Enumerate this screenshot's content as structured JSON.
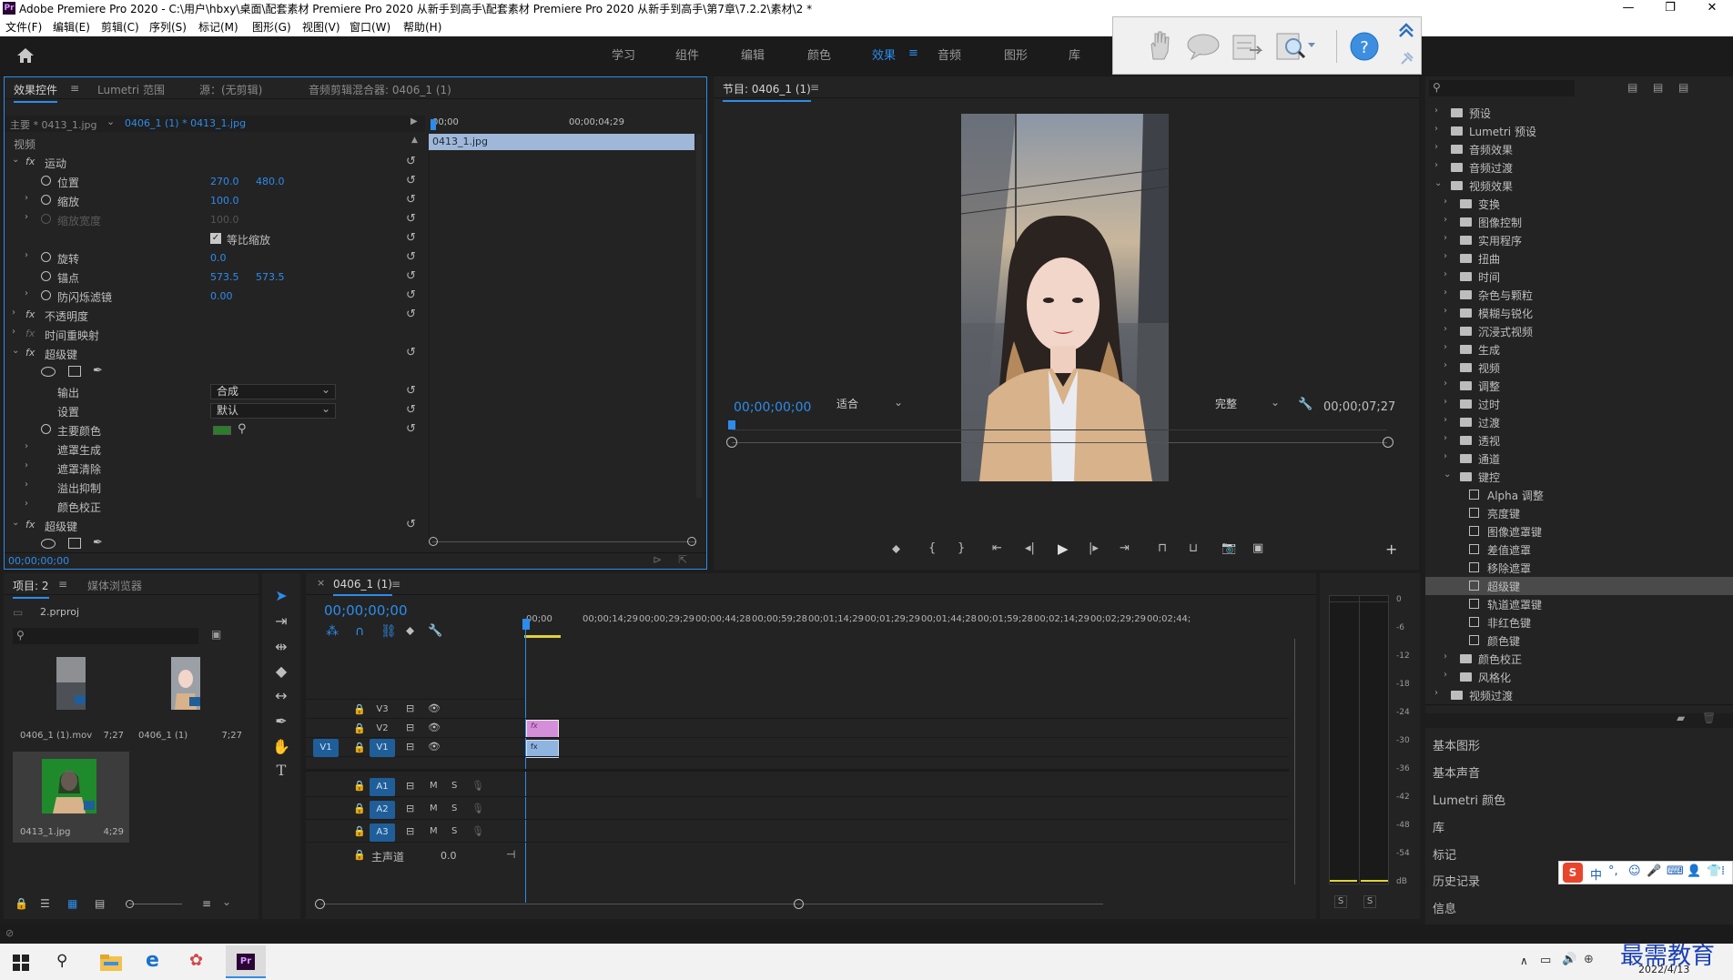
{
  "window": {
    "title": "Adobe Premiere Pro 2020 - C:\\用户\\hbxy\\桌面\\配套素材 Premiere Pro 2020 从新手到高手\\配套素材 Premiere Pro 2020 从新手到高手\\第7章\\7.2.2\\素材\\2 *",
    "app_icon": "Pr"
  },
  "menu": [
    "文件(F)",
    "编辑(E)",
    "剪辑(C)",
    "序列(S)",
    "标记(M)",
    "图形(G)",
    "视图(V)",
    "窗口(W)",
    "帮助(H)"
  ],
  "workspaces": {
    "tabs": [
      "学习",
      "组件",
      "编辑",
      "颜色",
      "效果",
      "音频",
      "图形",
      "库"
    ],
    "active": "效果"
  },
  "effect_controls": {
    "tabs": [
      "效果控件",
      "Lumetri 范围",
      "源：(无剪辑)",
      "音频剪辑混合器: 0406_1 (1)"
    ],
    "master": "主要 * 0413_1.jpg",
    "clip": "0406_1 (1) * 0413_1.jpg",
    "time_start": "00;00",
    "time_mid": "00;00;04;29",
    "clip_bar": "0413_1.jpg",
    "section_video": "视频",
    "motion": "运动",
    "position_label": "位置",
    "position_x": "270.0",
    "position_y": "480.0",
    "scale_label": "缩放",
    "scale_value": "100.0",
    "scale_width_label": "缩放宽度",
    "scale_width_value": "100.0",
    "uniform_label": "等比缩放",
    "rotation_label": "旋转",
    "rotation_value": "0.0",
    "anchor_label": "锚点",
    "anchor_x": "573.5",
    "anchor_y": "573.5",
    "flicker_label": "防闪烁滤镜",
    "flicker_value": "0.00",
    "opacity": "不透明度",
    "time_remap": "时间重映射",
    "ultra_key": "超级键",
    "output_label": "输出",
    "output_value": "合成",
    "setting_label": "设置",
    "setting_value": "默认",
    "key_color_label": "主要颜色",
    "key_color": "#2a7d2a",
    "matte_gen": "遮罩生成",
    "matte_clean": "遮罩清除",
    "spill": "溢出抑制",
    "color_correct": "颜色校正",
    "ultra_key2": "超级键",
    "timecode": "00;00;00;00"
  },
  "program_monitor": {
    "title": "节目: 0406_1 (1)",
    "timecode": "00;00;00;00",
    "fit": "适合",
    "quality": "完整",
    "duration": "00;00;07;27"
  },
  "effects_panel": {
    "items": [
      {
        "label": "预设",
        "level": 0,
        "type": "folder",
        "open": false
      },
      {
        "label": "Lumetri 预设",
        "level": 0,
        "type": "folder",
        "open": false
      },
      {
        "label": "音频效果",
        "level": 0,
        "type": "folder",
        "open": false
      },
      {
        "label": "音频过渡",
        "level": 0,
        "type": "folder",
        "open": false
      },
      {
        "label": "视频效果",
        "level": 0,
        "type": "folder",
        "open": true
      },
      {
        "label": "变换",
        "level": 1,
        "type": "folder",
        "open": false
      },
      {
        "label": "图像控制",
        "level": 1,
        "type": "folder",
        "open": false
      },
      {
        "label": "实用程序",
        "level": 1,
        "type": "folder",
        "open": false
      },
      {
        "label": "扭曲",
        "level": 1,
        "type": "folder",
        "open": false
      },
      {
        "label": "时间",
        "level": 1,
        "type": "folder",
        "open": false
      },
      {
        "label": "杂色与颗粒",
        "level": 1,
        "type": "folder",
        "open": false
      },
      {
        "label": "模糊与锐化",
        "level": 1,
        "type": "folder",
        "open": false
      },
      {
        "label": "沉浸式视频",
        "level": 1,
        "type": "folder",
        "open": false
      },
      {
        "label": "生成",
        "level": 1,
        "type": "folder",
        "open": false
      },
      {
        "label": "视频",
        "level": 1,
        "type": "folder",
        "open": false
      },
      {
        "label": "调整",
        "level": 1,
        "type": "folder",
        "open": false
      },
      {
        "label": "过时",
        "level": 1,
        "type": "folder",
        "open": false
      },
      {
        "label": "过渡",
        "level": 1,
        "type": "folder",
        "open": false
      },
      {
        "label": "透视",
        "level": 1,
        "type": "folder",
        "open": false
      },
      {
        "label": "通道",
        "level": 1,
        "type": "folder",
        "open": false
      },
      {
        "label": "键控",
        "level": 1,
        "type": "folder",
        "open": true
      },
      {
        "label": "Alpha 调整",
        "level": 2,
        "type": "effect"
      },
      {
        "label": "亮度键",
        "level": 2,
        "type": "effect"
      },
      {
        "label": "图像遮罩键",
        "level": 2,
        "type": "effect"
      },
      {
        "label": "差值遮罩",
        "level": 2,
        "type": "effect"
      },
      {
        "label": "移除遮罩",
        "level": 2,
        "type": "effect"
      },
      {
        "label": "超级键",
        "level": 2,
        "type": "effect",
        "selected": true
      },
      {
        "label": "轨道遮罩键",
        "level": 2,
        "type": "effect"
      },
      {
        "label": "非红色键",
        "level": 2,
        "type": "effect"
      },
      {
        "label": "颜色键",
        "level": 2,
        "type": "effect"
      },
      {
        "label": "颜色校正",
        "level": 1,
        "type": "folder",
        "open": false
      },
      {
        "label": "风格化",
        "level": 1,
        "type": "folder",
        "open": false
      },
      {
        "label": "视频过渡",
        "level": 0,
        "type": "folder",
        "open": false
      }
    ],
    "side_panels": [
      "基本图形",
      "基本声音",
      "Lumetri 颜色",
      "库",
      "标记",
      "历史记录",
      "信息"
    ]
  },
  "project": {
    "tabs": [
      "项目: 2",
      "媒体浏览器"
    ],
    "file": "2.prproj",
    "items": [
      {
        "name": "0406_1 (1).mov",
        "duration": "7;27"
      },
      {
        "name": "0406_1 (1)",
        "duration": "7;27"
      },
      {
        "name": "0413_1.jpg",
        "duration": "4;29"
      }
    ]
  },
  "timeline": {
    "tab": "0406_1 (1)",
    "timecode": "00;00;00;00",
    "ruler": [
      "00;00",
      "00;00;14;29",
      "00;00;29;29",
      "00;00;44;28",
      "00;00;59;28",
      "00;01;14;29",
      "00;01;29;29",
      "00;01;44;28",
      "00;01;59;28",
      "00;02;14;29",
      "00;02;29;29",
      "00;02;44;"
    ],
    "video_tracks": [
      "V3",
      "V2",
      "V1"
    ],
    "audio_tracks": [
      "A1",
      "A2",
      "A3"
    ],
    "source_patch": "V1",
    "master_label": "主声道",
    "master_value": "0.0",
    "m_label": "M",
    "s_label": "S"
  },
  "meters": {
    "scale": [
      "0",
      "-6",
      "-12",
      "-18",
      "-24",
      "-30",
      "-36",
      "-42",
      "-48",
      "-54",
      "dB"
    ],
    "solo": [
      "S",
      "S"
    ]
  },
  "taskbar": {
    "date": "2022/4/13",
    "watermark": "最需教育",
    "ime": "中"
  }
}
